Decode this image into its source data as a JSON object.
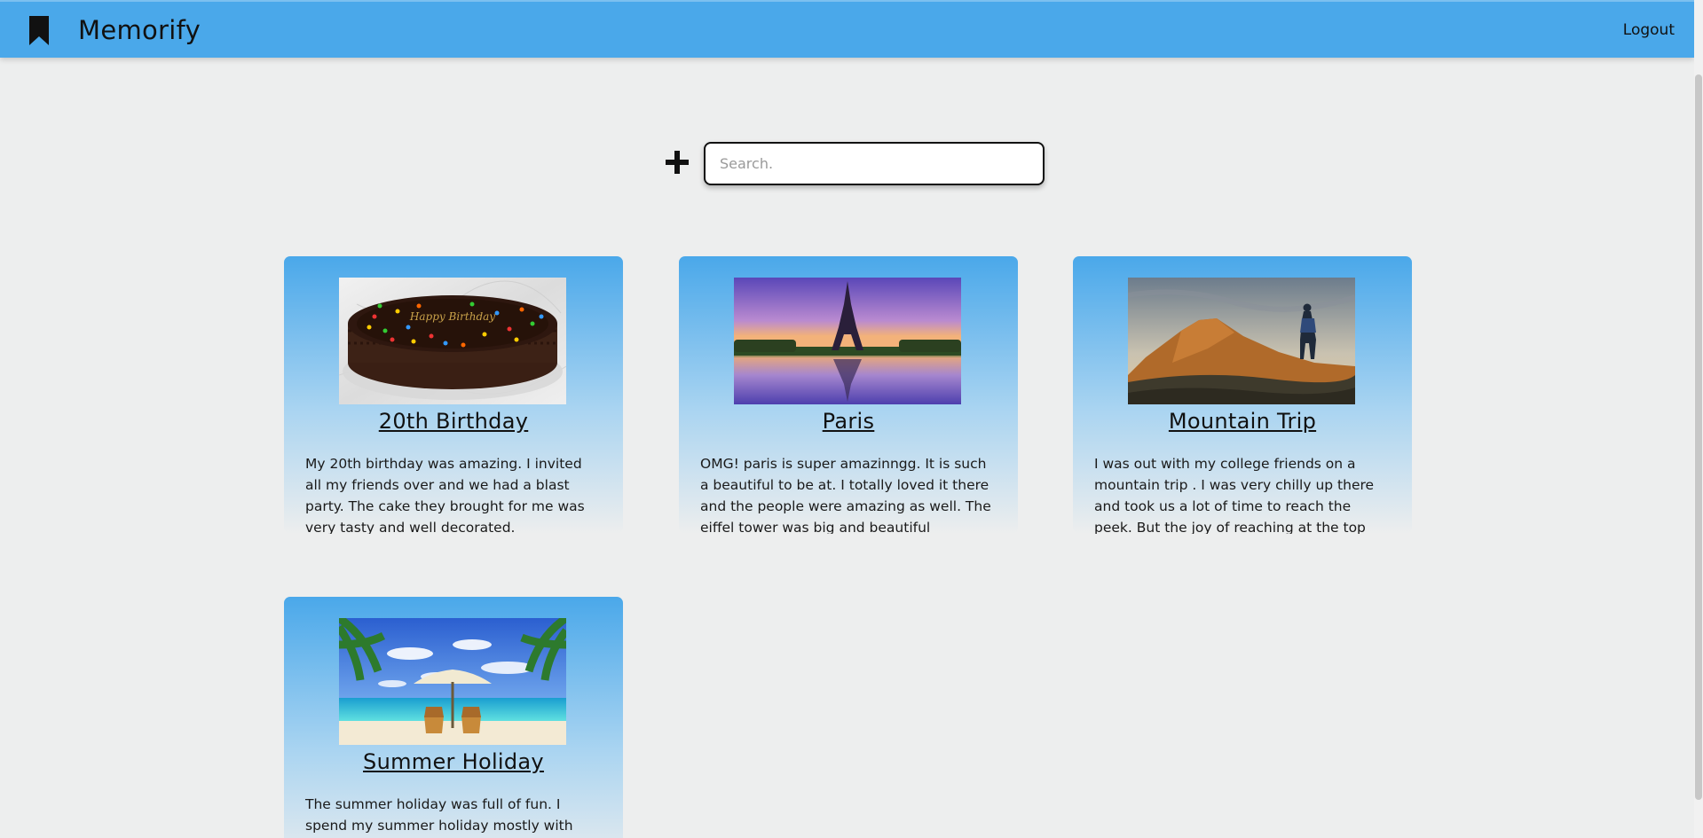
{
  "app": {
    "name": "Memorify",
    "logout_label": "Logout"
  },
  "search": {
    "placeholder": "Search."
  },
  "memories": [
    {
      "title": "20th Birthday",
      "description": "My 20th birthday was amazing. I invited all my friends over and we had a blast party. The cake they brought for me was very tasty and well decorated.",
      "image": "chocolate-birthday-cake",
      "cake_text": "Happy Birthday"
    },
    {
      "title": "Paris",
      "description": "OMG! paris is super amazinngg. It is such a beautiful to be at. I totally loved it there and the people were amazing as well. The eiffel tower was big and beautiful",
      "image": "eiffel-tower-sunset"
    },
    {
      "title": "Mountain Trip",
      "description": "I was out with my college friends on a mountain trip . I was very chilly up there and took us a lot of time to reach the peek. But the joy of reaching at the top",
      "image": "hiker-on-mountain"
    },
    {
      "title": "Summer Holiday",
      "description": "The summer holiday was full of fun. I spend my summer holiday mostly with",
      "image": "beach-umbrella-chairs"
    }
  ],
  "colors": {
    "navbar": "#4aa8ea",
    "background": "#edeeee"
  }
}
